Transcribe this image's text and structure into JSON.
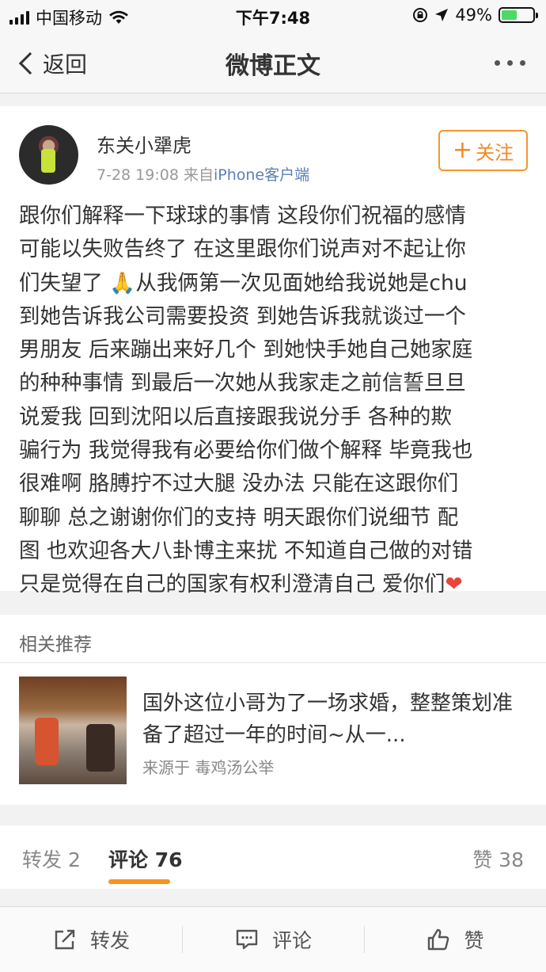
{
  "status_bar": {
    "carrier": "中国移动",
    "time": "下午7:48",
    "battery": "49%",
    "battery_level": 0.49
  },
  "nav": {
    "back_label": "返回",
    "title": "微博正文"
  },
  "post": {
    "username": "东关小犟虎",
    "time": "7-28 19:08",
    "source_prefix": "来自",
    "source": "iPhone客户端",
    "follow_label": "关注",
    "lines": [
      "跟你们解释一下球球的事情 这段你们祝福的感情",
      "可能以失败告终了 在这里跟你们说声对不起让你",
      "们失望了 🙏从我俩第一次见面她给我说她是chu",
      "到她告诉我公司需要投资 到她告诉我就谈过一个",
      "男朋友 后来蹦出来好几个 到她快手她自己她家庭",
      "的种种事情 到最后一次她从我家走之前信誓旦旦",
      "说爱我 回到沈阳以后直接跟我说分手  各种的欺",
      "骗行为 我觉得我有必要给你们做个解释 毕竟我也",
      "很难啊 胳膊拧不过大腿 没办法 只能在这跟你们",
      "聊聊 总之谢谢你们的支持 明天跟你们说细节 配",
      "图 也欢迎各大八卦博主来扰 不知道自己做的对错",
      "只是觉得在自己的国家有权利澄清自己 爱你们"
    ],
    "heart": "❤"
  },
  "related": {
    "title": "相关推荐",
    "headline": "国外这位小哥为了一场求婚，整整策划准备了超过一年的时间~从一...",
    "source": "来源于 毒鸡汤公举"
  },
  "tabs": {
    "repost": "转发 2",
    "comment": "评论 76",
    "like": "赞 38"
  },
  "toolbar": {
    "repost": "转发",
    "comment": "评论",
    "like": "赞"
  }
}
